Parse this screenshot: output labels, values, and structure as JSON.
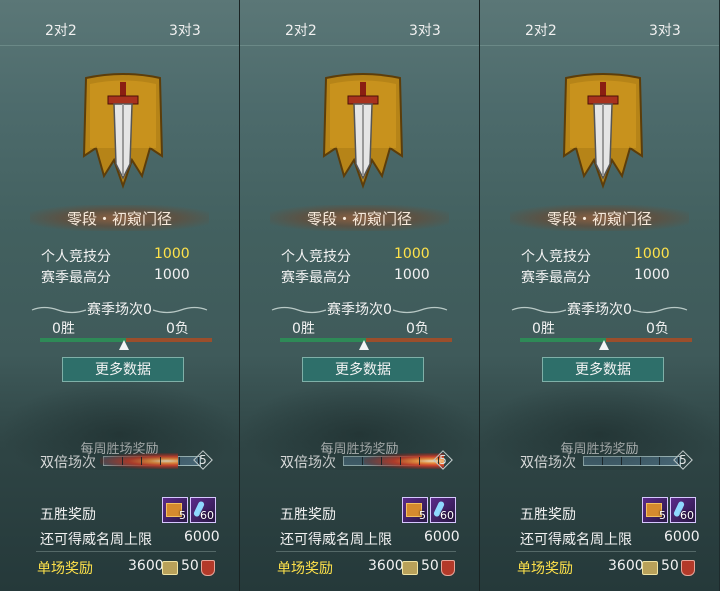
{
  "panels": [
    {
      "tabs": [
        "2对2",
        "3对3"
      ],
      "rank_name": "零段・初窥门径",
      "personal_score_label": "个人竞技分",
      "personal_score": "1000",
      "season_high_label": "赛季最高分",
      "season_high": "1000",
      "season_matches": "赛季场次0",
      "wins": "0胜",
      "losses": "0负",
      "win_ratio": 0.5,
      "more_button": "更多数据",
      "weekly_reward": "每周胜场奖励",
      "double_label": "双倍场次",
      "double_count": "5",
      "five_win_label": "五胜奖励",
      "item_a_count": "5",
      "item_b_count": "60",
      "limit_label": "还可得威名周上限",
      "limit_value": "6000",
      "single_label": "单场奖励",
      "single_value_a": "3600",
      "single_value_b": "50"
    },
    {
      "tabs": [
        "2对2",
        "3对3"
      ],
      "rank_name": "零段・初窥门径",
      "personal_score_label": "个人竞技分",
      "personal_score": "1000",
      "season_high_label": "赛季最高分",
      "season_high": "1000",
      "season_matches": "赛季场次0",
      "wins": "0胜",
      "losses": "0负",
      "win_ratio": 0.5,
      "more_button": "更多数据",
      "weekly_reward": "每周胜场奖励",
      "double_label": "双倍场次",
      "double_count": "5",
      "five_win_label": "五胜奖励",
      "item_a_count": "5",
      "item_b_count": "60",
      "limit_label": "还可得威名周上限",
      "limit_value": "6000",
      "single_label": "单场奖励",
      "single_value_a": "3600",
      "single_value_b": "50"
    },
    {
      "tabs": [
        "2对2",
        "3对3"
      ],
      "rank_name": "零段・初窥门径",
      "personal_score_label": "个人竞技分",
      "personal_score": "1000",
      "season_high_label": "赛季最高分",
      "season_high": "1000",
      "season_matches": "赛季场次0",
      "wins": "0胜",
      "losses": "0负",
      "win_ratio": 0.5,
      "more_button": "更多数据",
      "weekly_reward": "每周胜场奖励",
      "double_label": "双倍场次",
      "double_count": "5",
      "five_win_label": "五胜奖励",
      "item_a_count": "5",
      "item_b_count": "60",
      "limit_label": "还可得威名周上限",
      "limit_value": "6000",
      "single_label": "单场奖励",
      "single_value_a": "3600",
      "single_value_b": "50"
    }
  ],
  "colors": {
    "highlight": "#ffe24a",
    "button": "#2e6f6a",
    "win_bar": "#2e8a57",
    "loss_bar": "#9b4e2b"
  }
}
